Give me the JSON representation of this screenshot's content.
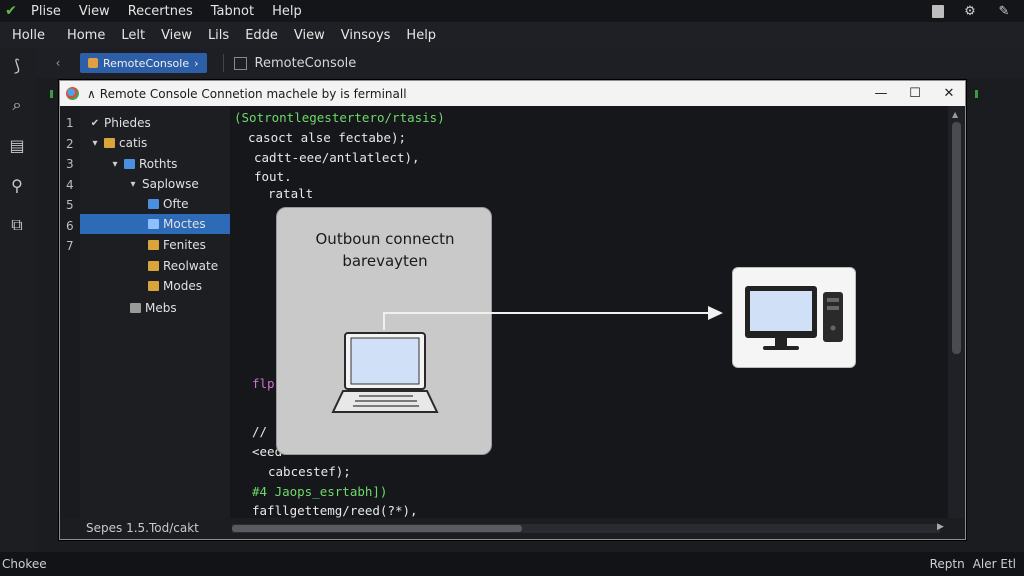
{
  "menubar": {
    "items": [
      "Plise",
      "View",
      "Recertnes",
      "Tabnot",
      "Help"
    ]
  },
  "navbar": {
    "items": [
      "Holle",
      "Home",
      "Lelt",
      "View",
      "Lils",
      "Edde",
      "View",
      "Vinsoys",
      "Help"
    ]
  },
  "tabs": {
    "active_label": "RemoteConsole",
    "plain_label": "RemoteConsole"
  },
  "window": {
    "title": "Remote Console Connetion machele by is ferminall",
    "minimize": "—",
    "maximize": "☐",
    "close": "✕"
  },
  "gutter": [
    "1",
    "2",
    "3",
    "4",
    "5",
    "6",
    "7"
  ],
  "tree": [
    {
      "label": "Phiedes",
      "arrow": "✔",
      "color": "#9a9a9a"
    },
    {
      "label": "catis",
      "arrow": "▾",
      "color": "#d9a43a"
    },
    {
      "label": "Rothts",
      "arrow": "▾",
      "color": "#4a8fe0"
    },
    {
      "label": "Saplowse",
      "arrow": "▾",
      "color": ""
    },
    {
      "label": "Ofte",
      "arrow": "",
      "color": "#4a8fe0"
    },
    {
      "label": "Moctes",
      "arrow": "",
      "color": "#4a8fe0"
    },
    {
      "label": "Fenites",
      "arrow": "",
      "color": "#d9a43a"
    },
    {
      "label": "Reolwate",
      "arrow": "",
      "color": "#d9a43a"
    },
    {
      "label": "Modes",
      "arrow": "",
      "color": "#d9a43a"
    },
    {
      "label": "Mebs",
      "arrow": "",
      "color": "#9a9a9a"
    }
  ],
  "code_lines": [
    {
      "text": "(Sotrontlegestertero/rtasis)",
      "color": "#6fd86a"
    },
    {
      "text": "casoct alse fectabe);",
      "color": "#e8e8e8"
    },
    {
      "text": "cadtt-eee/antlatlect),",
      "color": "#e8e8e8"
    },
    {
      "text": "fout.",
      "color": "#e8e8e8"
    },
    {
      "text": "ratalt",
      "color": "#e8e8e8"
    },
    {
      "text": "flp",
      "color": "#d070d0"
    },
    {
      "text": "// ",
      "color": "#e8e8e8"
    },
    {
      "text": "<eed",
      "color": "#e8e8e8"
    },
    {
      "text": "cabcestef);",
      "color": "#e8e8e8"
    },
    {
      "text": "#4 Jaops_esrtabh])",
      "color": "#6fd86a"
    },
    {
      "text": "fafllgettemg/reed(?*),",
      "color": "#e8e8e8"
    }
  ],
  "statusline": {
    "text": "Sepes  1.5.Tod/cakt"
  },
  "diagram": {
    "title_line1": "Outboun connectn",
    "title_line2": "barevayten"
  },
  "bottombar": {
    "left": "Chokee",
    "right1": "Reptn",
    "right2": "Aler Etl"
  }
}
